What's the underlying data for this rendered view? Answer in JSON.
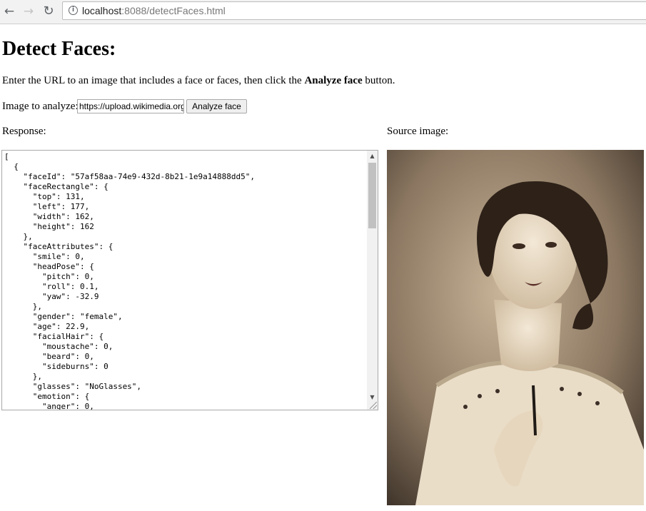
{
  "browser": {
    "url_host": "localhost",
    "url_port_path": ":8088/detectFaces.html",
    "icons": {
      "back": "arrow-left-icon",
      "forward": "arrow-right-icon",
      "reload": "reload-icon",
      "info": "info-icon"
    }
  },
  "page": {
    "title": "Detect Faces:",
    "intro_before": "Enter the URL to an image that includes a face or faces, then click the ",
    "intro_bold": "Analyze face",
    "intro_after": " button.",
    "image_label": "Image to analyze: ",
    "image_url_value": "https://upload.wikimedia.org",
    "analyze_button": "Analyze face",
    "response_label": "Response:",
    "source_label": "Source image:",
    "response_json": "[\n  {\n    \"faceId\": \"57af58aa-74e9-432d-8b21-1e9a14888dd5\",\n    \"faceRectangle\": {\n      \"top\": 131,\n      \"left\": 177,\n      \"width\": 162,\n      \"height\": 162\n    },\n    \"faceAttributes\": {\n      \"smile\": 0,\n      \"headPose\": {\n        \"pitch\": 0,\n        \"roll\": 0.1,\n        \"yaw\": -32.9\n      },\n      \"gender\": \"female\",\n      \"age\": 22.9,\n      \"facialHair\": {\n        \"moustache\": 0,\n        \"beard\": 0,\n        \"sideburns\": 0\n      },\n      \"glasses\": \"NoGlasses\",\n      \"emotion\": {\n        \"anger\": 0,"
  }
}
